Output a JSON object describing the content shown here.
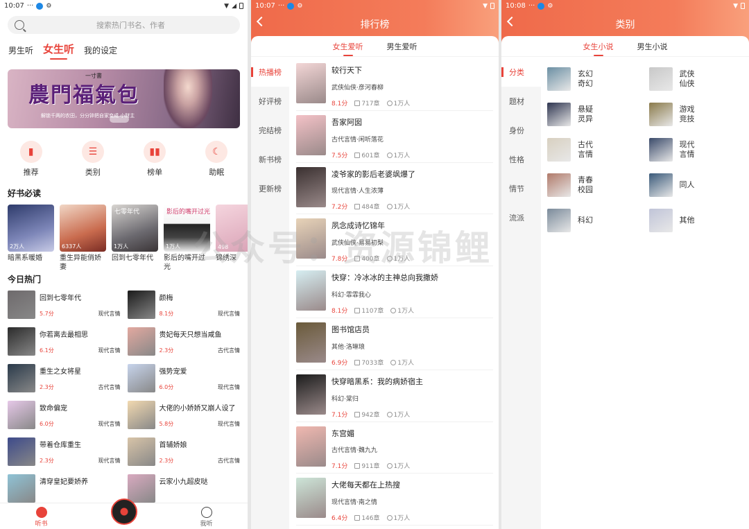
{
  "panel1": {
    "status": {
      "time": "10:07",
      "dots": "···"
    },
    "search_placeholder": "搜索热门书名、作者",
    "tabs": [
      "男生听",
      "女生听",
      "我的设定"
    ],
    "banner": {
      "title": "農門福氣包",
      "logo": "一寸書",
      "subtitle": "解锁千两的农田，分分钟把自家变成 小财主"
    },
    "quick": [
      "推荐",
      "类别",
      "榜单",
      "助眠"
    ],
    "must_read_title": "好书必读",
    "must_read": [
      {
        "name": "暗黑系暖婚",
        "count": "2万人",
        "cover_text": ""
      },
      {
        "name": "重生异能俏娇妻",
        "count": "6337人",
        "cover_text": ""
      },
      {
        "name": "回到七零年代",
        "count": "1万人",
        "cover_text": "七零年代"
      },
      {
        "name": "影后的嘴开过光",
        "count": "1万人",
        "cover_text": "影后的嘴开过光"
      },
      {
        "name": "锦绣深",
        "count": "498",
        "cover_text": ""
      }
    ],
    "hot_title": "今日热门",
    "hot": [
      {
        "name": "回到七零年代",
        "score": "5.7分",
        "genre": "现代言情"
      },
      {
        "name": "颜梅",
        "score": "8.1分",
        "genre": "现代言情"
      },
      {
        "name": "你若离去最相思",
        "score": "6.1分",
        "genre": "现代言情"
      },
      {
        "name": "贵妃每天只想当咸鱼",
        "score": "2.3分",
        "genre": "古代言情"
      },
      {
        "name": "重生之女将星",
        "score": "2.3分",
        "genre": "古代言情"
      },
      {
        "name": "强势宠爱",
        "score": "6.0分",
        "genre": "现代言情"
      },
      {
        "name": "致命偏宠",
        "score": "6.0分",
        "genre": "现代言情"
      },
      {
        "name": "大佬的小娇娇又崩人设了",
        "score": "5.8分",
        "genre": "现代言情"
      },
      {
        "name": "带着仓库重生",
        "score": "2.3分",
        "genre": "现代言情"
      },
      {
        "name": "首辅娇娘",
        "score": "2.3分",
        "genre": "古代言情"
      },
      {
        "name": "清穿皇妃要娇养",
        "score": "",
        "genre": ""
      },
      {
        "name": "云家小九超皮哒",
        "score": "",
        "genre": ""
      }
    ],
    "nav": {
      "listen": "听书",
      "mine": "我听"
    }
  },
  "panel2": {
    "status": {
      "time": "10:07",
      "dots": "···"
    },
    "title": "排行榜",
    "tabs": [
      "女生爱听",
      "男生爱听"
    ],
    "side": [
      "热播榜",
      "好评榜",
      "完结榜",
      "新书榜",
      "更新榜"
    ],
    "list": [
      {
        "name": "较行天下",
        "author": "武侠仙侠·彦河春柳",
        "score": "8.1分",
        "chapters": "717章",
        "listeners": "1万人"
      },
      {
        "name": "吾家阿囡",
        "author": "古代言情·闲听落花",
        "score": "7.5分",
        "chapters": "601章",
        "listeners": "1万人"
      },
      {
        "name": "凌爷家的影后老婆飒爆了",
        "author": "现代言情·人生浓薄",
        "score": "7.2分",
        "chapters": "484章",
        "listeners": "1万人"
      },
      {
        "name": "夙念成诗忆锦年",
        "author": "武侠仙侠·易易初梨",
        "score": "7.8分",
        "chapters": "400章",
        "listeners": "1万人"
      },
      {
        "name": "快穿：冷冰冰的主神总向我撒娇",
        "author": "科幻·霏霏我心",
        "score": "8.1分",
        "chapters": "1107章",
        "listeners": "1万人"
      },
      {
        "name": "图书馆店员",
        "author": "其他·洛琳琅",
        "score": "6.9分",
        "chapters": "7033章",
        "listeners": "1万人"
      },
      {
        "name": "快穿暗黑系：我的病娇宿主",
        "author": "科幻·棠归",
        "score": "7.1分",
        "chapters": "942章",
        "listeners": "1万人"
      },
      {
        "name": "东宫媚",
        "author": "古代言情·魏九九",
        "score": "7.1分",
        "chapters": "911章",
        "listeners": "1万人"
      },
      {
        "name": "大佬每天都在上热搜",
        "author": "现代言情·南之情",
        "score": "6.4分",
        "chapters": "146章",
        "listeners": "1万人"
      }
    ]
  },
  "panel3": {
    "status": {
      "time": "10:08",
      "dots": "···"
    },
    "title": "类别",
    "tabs": [
      "女生小说",
      "男生小说"
    ],
    "side": [
      "分类",
      "题材",
      "身份",
      "性格",
      "情节",
      "流派"
    ],
    "categories": [
      "玄幻奇幻",
      "武侠仙侠",
      "悬疑灵异",
      "游戏竞技",
      "古代言情",
      "现代言情",
      "青春校园",
      "同人",
      "科幻",
      "其他"
    ]
  },
  "watermark": "公众号：资源锦鲤",
  "colors": {
    "accent": "#e8433a",
    "header_gradient_start": "#ef6a4a"
  }
}
